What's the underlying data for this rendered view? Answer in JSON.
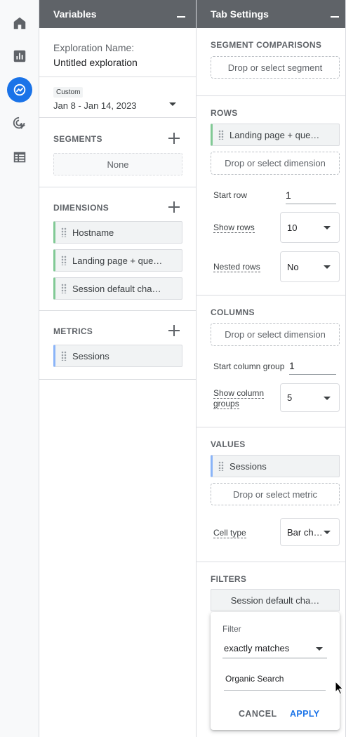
{
  "rail": {
    "items": [
      {
        "icon": "home-icon",
        "active": false
      },
      {
        "icon": "reports-icon",
        "active": false
      },
      {
        "icon": "explore-icon",
        "active": true
      },
      {
        "icon": "advertising-icon",
        "active": false
      },
      {
        "icon": "configure-icon",
        "active": false
      }
    ],
    "accent": "#1a73e8"
  },
  "variables": {
    "title": "Variables",
    "exploration_name_label": "Exploration Name:",
    "exploration_name": "Untitled exploration",
    "date_chip": "Custom",
    "date_range": "Jan 8 - Jan 14, 2023",
    "segments": {
      "title": "SEGMENTS",
      "empty": "None"
    },
    "dimensions": {
      "title": "DIMENSIONS",
      "items": [
        "Hostname",
        "Landing page + que…",
        "Session default cha…"
      ]
    },
    "metrics": {
      "title": "METRICS",
      "items": [
        "Sessions"
      ]
    }
  },
  "tab_settings": {
    "title": "Tab Settings",
    "segment_comparisons": {
      "title": "SEGMENT COMPARISONS",
      "drop": "Drop or select segment"
    },
    "rows": {
      "title": "ROWS",
      "item": "Landing page + que…",
      "drop": "Drop or select dimension",
      "start_row_label": "Start row",
      "start_row": "1",
      "show_rows_label": "Show rows",
      "show_rows": "10",
      "nested_rows_label": "Nested rows",
      "nested_rows": "No"
    },
    "columns": {
      "title": "COLUMNS",
      "drop": "Drop or select dimension",
      "start_group_label": "Start column group",
      "start_group": "1",
      "show_groups_label_1": "Show column",
      "show_groups_label_2": "groups",
      "show_groups": "5"
    },
    "values": {
      "title": "VALUES",
      "item": "Sessions",
      "drop": "Drop or select metric",
      "cell_type_label": "Cell type",
      "cell_type": "Bar ch…"
    },
    "filters": {
      "title": "FILTERS",
      "item": "Session default cha…"
    }
  },
  "filter_popover": {
    "title": "Filter",
    "match_type": "exactly matches",
    "value": "Organic Search",
    "cancel": "CANCEL",
    "apply": "APPLY"
  }
}
